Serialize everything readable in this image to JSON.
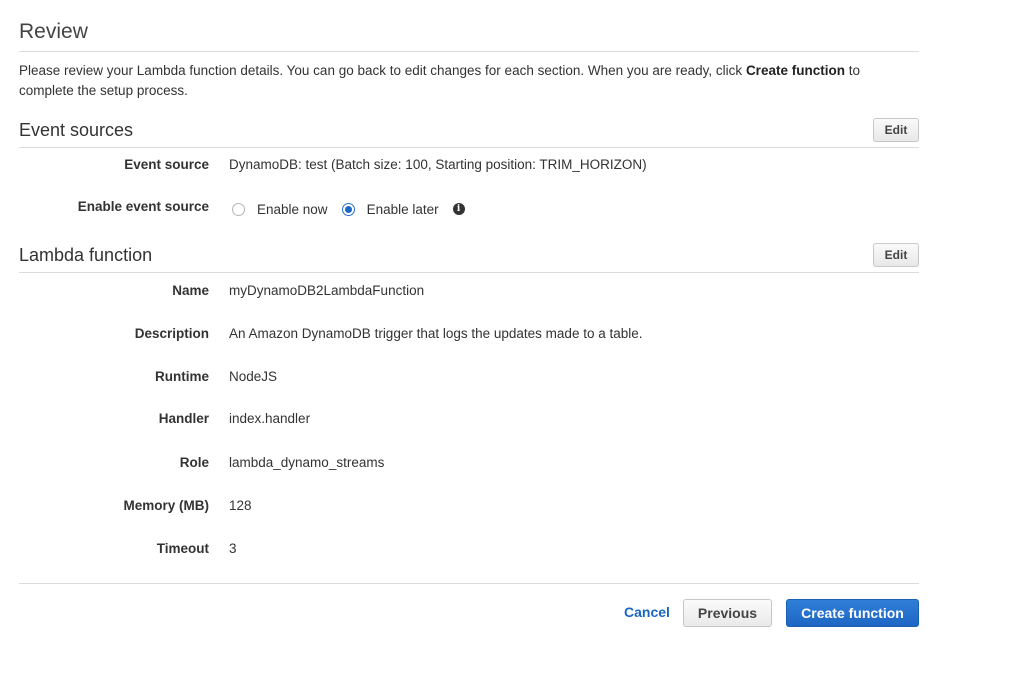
{
  "page": {
    "title": "Review",
    "intro_before": "Please review your Lambda function details. You can go back to edit changes for each section. When you are ready, click ",
    "intro_bold": "Create function",
    "intro_after": " to complete the setup process."
  },
  "event_sources": {
    "title": "Event sources",
    "edit_label": "Edit",
    "event_source_label": "Event source",
    "event_source_value": "DynamoDB: test (Batch size: 100, Starting position: TRIM_HORIZON)",
    "enable_label": "Enable event source",
    "options": [
      {
        "label": "Enable now",
        "selected": false
      },
      {
        "label": "Enable later",
        "selected": true
      }
    ],
    "info_icon": "info-icon"
  },
  "lambda_function": {
    "title": "Lambda function",
    "edit_label": "Edit",
    "fields": [
      {
        "label": "Name",
        "value": "myDynamoDB2LambdaFunction"
      },
      {
        "label": "Description",
        "value": "An Amazon DynamoDB trigger that logs the updates made to a table."
      },
      {
        "label": "Runtime",
        "value": "NodeJS"
      },
      {
        "label": "Handler",
        "value": "index.handler"
      },
      {
        "label": "Role",
        "value": "lambda_dynamo_streams"
      },
      {
        "label": "Memory (MB)",
        "value": "128"
      },
      {
        "label": "Timeout",
        "value": "3"
      }
    ]
  },
  "footer": {
    "cancel_label": "Cancel",
    "previous_label": "Previous",
    "create_label": "Create function"
  },
  "colors": {
    "primary": "#1e66c4",
    "link": "#1a66c2"
  }
}
